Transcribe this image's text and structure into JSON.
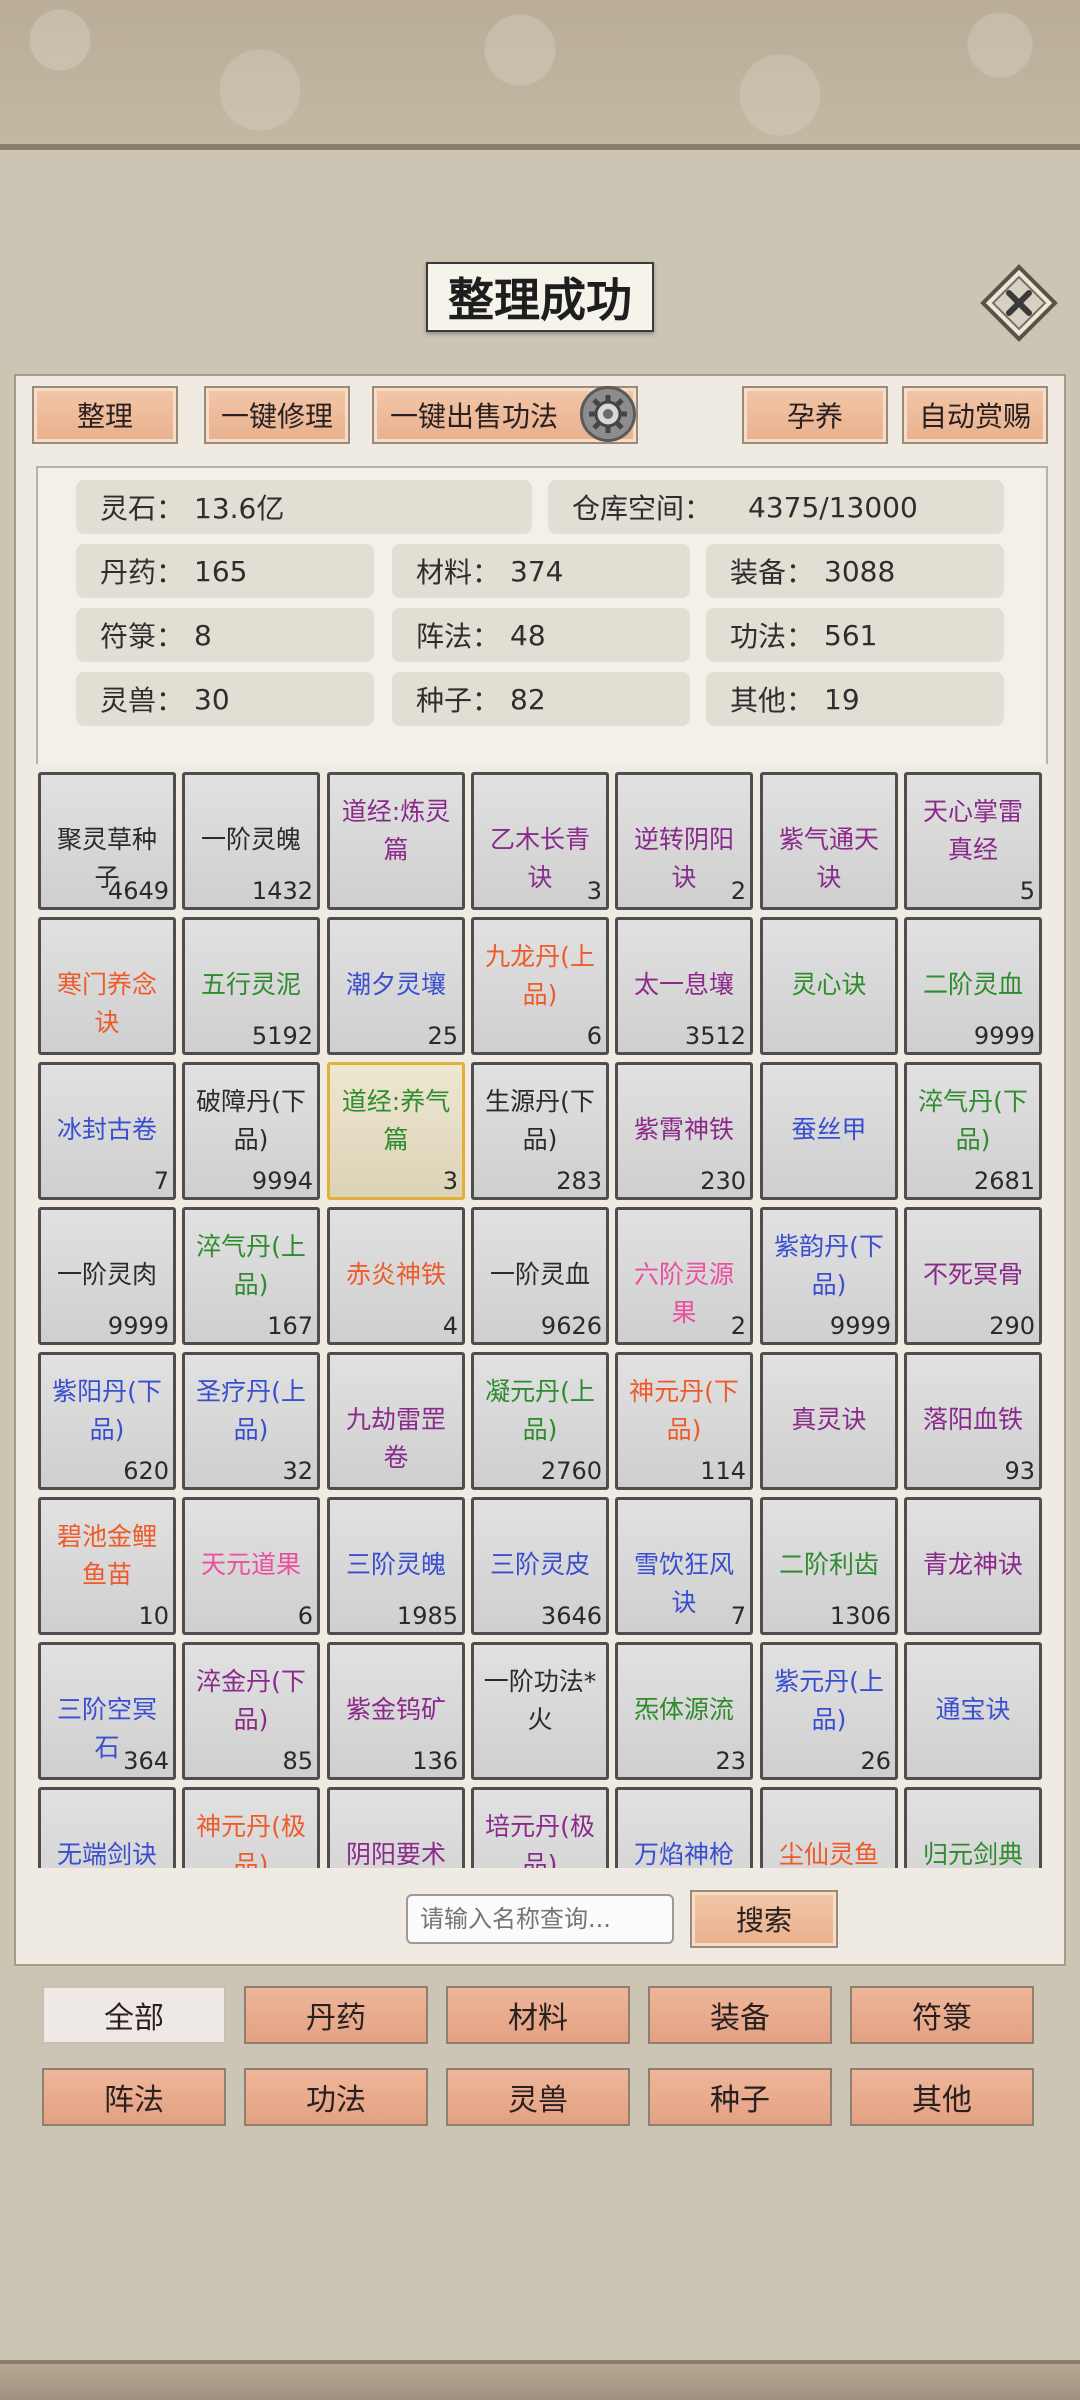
{
  "toast": "整理成功",
  "toolbar": {
    "sort": "整理",
    "repair_all": "一键修理",
    "sell_skills": "一键出售功法",
    "incubate": "孕养",
    "auto_reward": "自动赏赐"
  },
  "stats": {
    "spirit_stone_label": "灵石：",
    "spirit_stone_value": "13.6亿",
    "storage_label": "仓库空间：",
    "storage_value": "4375/13000",
    "pills_label": "丹药：",
    "pills_value": "165",
    "materials_label": "材料：",
    "materials_value": "374",
    "equipment_label": "装备：",
    "equipment_value": "3088",
    "talismans_label": "符箓：",
    "talismans_value": "8",
    "formations_label": "阵法：",
    "formations_value": "48",
    "skills_label": "功法：",
    "skills_value": "561",
    "beasts_label": "灵兽：",
    "beasts_value": "30",
    "seeds_label": "种子：",
    "seeds_value": "82",
    "other_label": "其他：",
    "other_value": "19"
  },
  "items": [
    {
      "name": "聚灵草种子",
      "count": "4649",
      "color": "black"
    },
    {
      "name": "一阶灵魄",
      "count": "1432",
      "color": "black"
    },
    {
      "name": "道经:炼灵篇",
      "count": "",
      "color": "purple"
    },
    {
      "name": "乙木长青诀",
      "count": "3",
      "color": "purple"
    },
    {
      "name": "逆转阴阳诀",
      "count": "2",
      "color": "purple"
    },
    {
      "name": "紫气通天诀",
      "count": "",
      "color": "purple"
    },
    {
      "name": "天心掌雷真经",
      "count": "5",
      "color": "purple"
    },
    {
      "name": "寒门养念诀",
      "count": "",
      "color": "orange"
    },
    {
      "name": "五行灵泥",
      "count": "5192",
      "color": "green"
    },
    {
      "name": "潮夕灵壤",
      "count": "25",
      "color": "blue"
    },
    {
      "name": "九龙丹(上品)",
      "count": "6",
      "color": "orange"
    },
    {
      "name": "太一息壤",
      "count": "3512",
      "color": "purple"
    },
    {
      "name": "灵心诀",
      "count": "",
      "color": "green"
    },
    {
      "name": "二阶灵血",
      "count": "9999",
      "color": "green"
    },
    {
      "name": "冰封古卷",
      "count": "7",
      "color": "blue"
    },
    {
      "name": "破障丹(下品)",
      "count": "9994",
      "color": "black"
    },
    {
      "name": "道经:养气篇",
      "count": "3",
      "color": "green"
    },
    {
      "name": "生源丹(下品)",
      "count": "283",
      "color": "black"
    },
    {
      "name": "紫霄神铁",
      "count": "230",
      "color": "purple"
    },
    {
      "name": "蚕丝甲",
      "count": "",
      "color": "blue"
    },
    {
      "name": "淬气丹(下品)",
      "count": "2681",
      "color": "green"
    },
    {
      "name": "一阶灵肉",
      "count": "9999",
      "color": "black"
    },
    {
      "name": "淬气丹(上品)",
      "count": "167",
      "color": "green"
    },
    {
      "name": "赤炎神铁",
      "count": "4",
      "color": "orange"
    },
    {
      "name": "一阶灵血",
      "count": "9626",
      "color": "black"
    },
    {
      "name": "六阶灵源果",
      "count": "2",
      "color": "pink"
    },
    {
      "name": "紫韵丹(下品)",
      "count": "9999",
      "color": "blue"
    },
    {
      "name": "不死冥骨",
      "count": "290",
      "color": "purple"
    },
    {
      "name": "紫阳丹(下品)",
      "count": "620",
      "color": "blue"
    },
    {
      "name": "圣疗丹(上品)",
      "count": "32",
      "color": "blue"
    },
    {
      "name": "九劫雷罡卷",
      "count": "",
      "color": "purple"
    },
    {
      "name": "凝元丹(上品)",
      "count": "2760",
      "color": "green"
    },
    {
      "name": "神元丹(下品)",
      "count": "114",
      "color": "orange"
    },
    {
      "name": "真灵诀",
      "count": "",
      "color": "purple"
    },
    {
      "name": "落阳血铁",
      "count": "93",
      "color": "purple"
    },
    {
      "name": "碧池金鲤鱼苗",
      "count": "10",
      "color": "orange"
    },
    {
      "name": "天元道果",
      "count": "6",
      "color": "pink"
    },
    {
      "name": "三阶灵魄",
      "count": "1985",
      "color": "blue"
    },
    {
      "name": "三阶灵皮",
      "count": "3646",
      "color": "blue"
    },
    {
      "name": "雪饮狂风诀",
      "count": "7",
      "color": "blue"
    },
    {
      "name": "二阶利齿",
      "count": "1306",
      "color": "green"
    },
    {
      "name": "青龙神诀",
      "count": "",
      "color": "purple"
    },
    {
      "name": "三阶空冥石",
      "count": "364",
      "color": "blue"
    },
    {
      "name": "淬金丹(下品)",
      "count": "85",
      "color": "purple"
    },
    {
      "name": "紫金钨矿",
      "count": "136",
      "color": "purple"
    },
    {
      "name": "一阶功法*火",
      "count": "",
      "color": "black"
    },
    {
      "name": "炁体源流",
      "count": "23",
      "color": "green"
    },
    {
      "name": "紫元丹(上品)",
      "count": "26",
      "color": "blue"
    },
    {
      "name": "通宝诀",
      "count": "",
      "color": "blue"
    },
    {
      "name": "无端剑诀",
      "count": "",
      "color": "blue"
    },
    {
      "name": "神元丹(极品)",
      "count": "",
      "color": "orange"
    },
    {
      "name": "阴阳要术",
      "count": "",
      "color": "purple"
    },
    {
      "name": "培元丹(极品)",
      "count": "",
      "color": "purple"
    },
    {
      "name": "万焰神枪诀",
      "count": "",
      "color": "blue"
    },
    {
      "name": "尘仙灵鱼",
      "count": "",
      "color": "orange"
    },
    {
      "name": "归元剑典",
      "count": "",
      "color": "green"
    }
  ],
  "search": {
    "placeholder": "请输入名称查询...",
    "button": "搜索"
  },
  "tabs": [
    "全部",
    "丹药",
    "材料",
    "装备",
    "符箓",
    "阵法",
    "功法",
    "灵兽",
    "种子",
    "其他"
  ],
  "active_tab": "全部",
  "selected_item": "道经:养气篇",
  "colors": {
    "black": "#2b2b2b",
    "purple": "#8a2a8a",
    "green": "#2e8b2e",
    "blue": "#3a4fd0",
    "orange": "#ee5a2a",
    "pink": "#ec4fa0",
    "button": "#eab394",
    "selected_border": "#e2b03a"
  }
}
